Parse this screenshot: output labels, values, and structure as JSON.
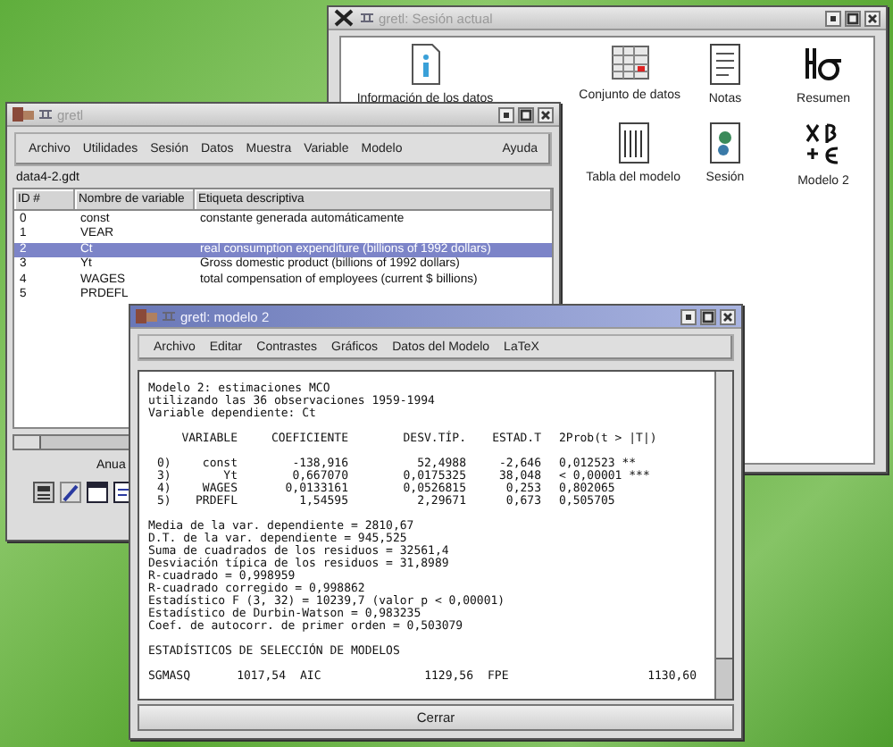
{
  "session_window": {
    "title": "gretl: Sesión actual",
    "active": false,
    "icons": [
      {
        "label": "Información de los datos",
        "kind": "info"
      },
      {
        "label": "Conjunto de datos",
        "kind": "dataset"
      },
      {
        "label": "Notas",
        "kind": "notes"
      },
      {
        "label": "Resumen",
        "kind": "summary"
      },
      {
        "label": "Tabla del modelo",
        "kind": "modeltable"
      },
      {
        "label": "Sesión",
        "kind": "session"
      },
      {
        "label": "Modelo 2",
        "kind": "model"
      }
    ]
  },
  "main_window": {
    "title": "gretl",
    "active": false,
    "menu": [
      "Archivo",
      "Utilidades",
      "Sesión",
      "Datos",
      "Muestra",
      "Variable",
      "Modelo"
    ],
    "help_menu": "Ayuda",
    "filename": "data4-2.gdt",
    "columns": [
      "ID #",
      "Nombre de variable",
      "Etiqueta descriptiva"
    ],
    "rows": [
      {
        "id": "0",
        "name": "const",
        "label": "constante generada automáticamente",
        "selected": false
      },
      {
        "id": "1",
        "name": "VEAR",
        "label": "",
        "selected": false
      },
      {
        "id": "2",
        "name": "Ct",
        "label": "real consumption expenditure (billions of 1992 dollars)",
        "selected": true
      },
      {
        "id": "3",
        "name": "Yt",
        "label": "Gross domestic product (billions of 1992 dollars)",
        "selected": false
      },
      {
        "id": "4",
        "name": "WAGES",
        "label": "total compensation of employees (current $ billions)",
        "selected": false
      },
      {
        "id": "5",
        "name": "PRDEFL",
        "label": "",
        "selected": false
      }
    ],
    "status_label": "Anua"
  },
  "model_window": {
    "title": "gretl: modelo 2",
    "active": true,
    "menu": [
      "Archivo",
      "Editar",
      "Contrastes",
      "Gráficos",
      "Datos del Modelo",
      "LaTeX"
    ],
    "header_lines": [
      "Modelo 2: estimaciones MCO",
      "utilizando las 36 observaciones 1959-1994",
      "Variable dependiente: Ct"
    ],
    "coef_columns": [
      "VARIABLE",
      "COEFICIENTE",
      "DESV.TÍP.",
      "ESTAD.T",
      "2Prob(t > |T|)"
    ],
    "coef_rows": [
      {
        "index": "0)",
        "variable": "const",
        "coef": "-138,916",
        "stderr": "52,4988",
        "t": "-2,646",
        "p": "0,012523",
        "signif": "**"
      },
      {
        "index": "3)",
        "variable": "Yt",
        "coef": "0,667070",
        "stderr": "0,0175325",
        "t": "38,048",
        "p": "< 0,00001",
        "signif": "***"
      },
      {
        "index": "4)",
        "variable": "WAGES",
        "coef": "0,0133161",
        "stderr": "0,0526815",
        "t": "0,253",
        "p": "0,802065",
        "signif": ""
      },
      {
        "index": "5)",
        "variable": "PRDEFL",
        "coef": "1,54595",
        "stderr": "2,29671",
        "t": "0,673",
        "p": "0,505705",
        "signif": ""
      }
    ],
    "stat_lines": [
      "Media de la var. dependiente = 2810,67",
      "D.T. de la var. dependiente = 945,525",
      "Suma de cuadrados de los residuos = 32561,4",
      "Desviación típica de los residuos = 31,8989",
      "R-cuadrado = 0,998959",
      "R-cuadrado corregido = 0,998862",
      "Estadístico F (3, 32) = 10239,7 (valor p < 0,00001)",
      "Estadístico de Durbin-Watson = 0,983235",
      "Coef. de autocorr. de primer orden = 0,503079"
    ],
    "selection_title": "ESTADÍSTICOS DE SELECCIÓN DE MODELOS",
    "selection_row": [
      "SGMASQ",
      "1017,54",
      "AIC",
      "1129,56",
      "FPE",
      "1130,60"
    ],
    "close_button": "Cerrar"
  }
}
